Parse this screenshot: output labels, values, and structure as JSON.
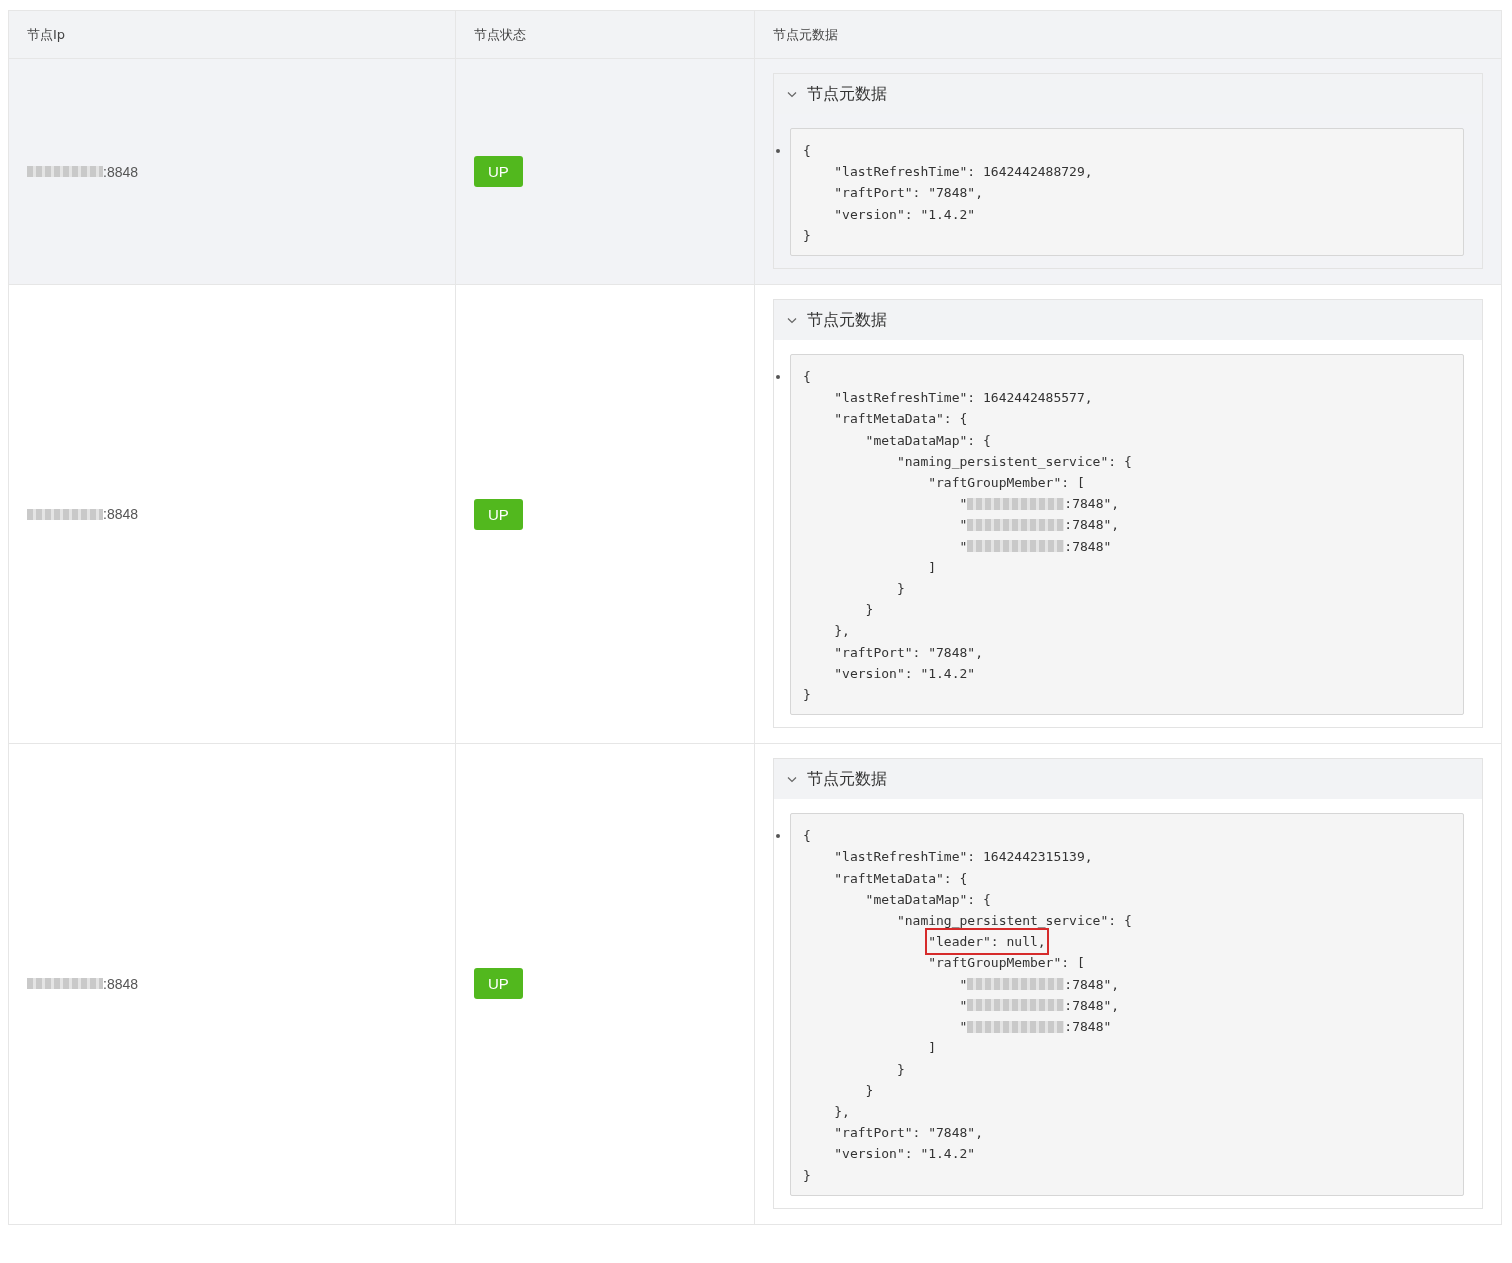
{
  "table": {
    "columns": [
      "节点Ip",
      "节点状态",
      "节点元数据"
    ],
    "rows": [
      {
        "hovered": true,
        "ip": {
          "redacted": true,
          "suffix": ":8848"
        },
        "status": {
          "label": "UP",
          "kind": "up"
        },
        "panel": {
          "title": "节点元数据",
          "expanded": true,
          "lines": [
            {
              "text": "{"
            },
            {
              "text": "    \"lastRefreshTime\": 1642442488729,"
            },
            {
              "text": "    \"raftPort\": \"7848\","
            },
            {
              "text": "    \"version\": \"1.4.2\""
            },
            {
              "text": "}"
            }
          ]
        }
      },
      {
        "hovered": false,
        "ip": {
          "redacted": true,
          "suffix": ":8848"
        },
        "status": {
          "label": "UP",
          "kind": "up"
        },
        "panel": {
          "title": "节点元数据",
          "expanded": true,
          "lines": [
            {
              "text": "{"
            },
            {
              "text": "    \"lastRefreshTime\": 1642442485577,"
            },
            {
              "text": "    \"raftMetaData\": {"
            },
            {
              "text": "        \"metaDataMap\": {"
            },
            {
              "text": "            \"naming_persistent_service\": {"
            },
            {
              "text": "                \"raftGroupMember\": ["
            },
            {
              "text": "                    \"",
              "redacted": true,
              "rest": ":7848\","
            },
            {
              "text": "                    \"",
              "redacted": true,
              "rest": ":7848\","
            },
            {
              "text": "                    \"",
              "redacted": true,
              "rest": ":7848\""
            },
            {
              "text": "                ]"
            },
            {
              "text": "            }"
            },
            {
              "text": "        }"
            },
            {
              "text": "    },"
            },
            {
              "text": "    \"raftPort\": \"7848\","
            },
            {
              "text": "    \"version\": \"1.4.2\""
            },
            {
              "text": "}"
            }
          ]
        }
      },
      {
        "hovered": false,
        "ip": {
          "redacted": true,
          "suffix": ":8848"
        },
        "status": {
          "label": "UP",
          "kind": "up"
        },
        "panel": {
          "title": "节点元数据",
          "expanded": true,
          "lines": [
            {
              "text": "{"
            },
            {
              "text": "    \"lastRefreshTime\": 1642442315139,"
            },
            {
              "text": "    \"raftMetaData\": {"
            },
            {
              "text": "        \"metaDataMap\": {"
            },
            {
              "text": "            \"naming_persistent_service\": {"
            },
            {
              "text": "                \"leader\": null,",
              "highlighted": true
            },
            {
              "text": "                \"raftGroupMember\": ["
            },
            {
              "text": "                    \"",
              "redacted": true,
              "rest": ":7848\","
            },
            {
              "text": "                    \"",
              "redacted": true,
              "rest": ":7848\","
            },
            {
              "text": "                    \"",
              "redacted": true,
              "rest": ":7848\""
            },
            {
              "text": "                ]"
            },
            {
              "text": "            }"
            },
            {
              "text": "        }"
            },
            {
              "text": "    },"
            },
            {
              "text": "    \"raftPort\": \"7848\","
            },
            {
              "text": "    \"version\": \"1.4.2\""
            },
            {
              "text": "}"
            }
          ]
        }
      }
    ]
  }
}
